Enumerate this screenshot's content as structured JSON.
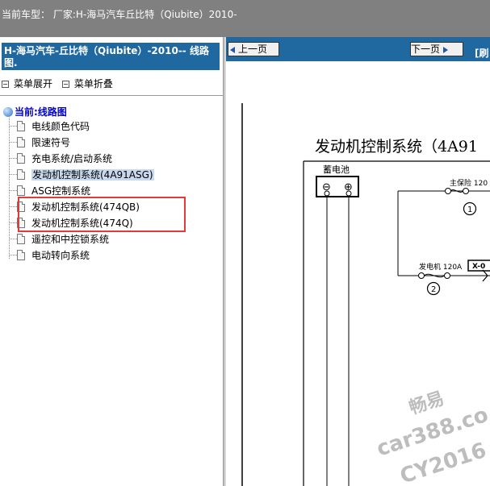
{
  "top": {
    "current_model_label": "当前车型：",
    "manufacturer_text": "厂家:H-海马汽车丘比特（Qiubite）2010-"
  },
  "left_panel": {
    "title": "H-海马汽车-丘比特（Qiubite）-2010-- 线路图.",
    "expand_label": "菜单展开",
    "collapse_label": "菜单折叠",
    "root_label": "当前:线路图",
    "items": [
      "电线颜色代码",
      "限速符号",
      "充电系统/启动系统",
      "发动机控制系统(4A91ASG)",
      "ASG控制系统",
      "发动机控制系统(474QB)",
      "发动机控制系统(474Q)",
      "遥控和中控锁系统",
      "电动转向系统"
    ],
    "selected_index": 3
  },
  "nav": {
    "prev_label": "上一页",
    "next_label": "下一页",
    "refresh_label": "[刷"
  },
  "diagram": {
    "title": "发动机控制系统（4A91",
    "battery_label": "蓄电池",
    "minus_symbol": "⊖",
    "plus_symbol": "⊕",
    "main_fuse_label": "主保险 120",
    "fuse1_number": "1",
    "alternator_label": "发电机  120A",
    "connector_label": "X-0",
    "fuse2_number": "2"
  },
  "watermark": {
    "line1": "畅易",
    "line2": "car388.co",
    "line3": "CY2016"
  },
  "colors": {
    "header_blue": "#1f68a0",
    "top_gray": "#808080",
    "highlight_red": "#e03a3a",
    "selection_bg": "#c8d8ee"
  }
}
